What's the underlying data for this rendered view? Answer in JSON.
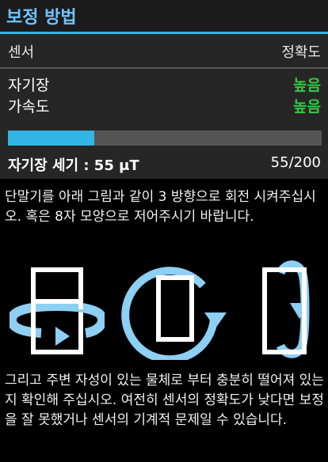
{
  "title": "보정 방법",
  "header": {
    "sensor": "센서",
    "accuracy": "정확도"
  },
  "rows": [
    {
      "label": "자기장",
      "value": "높음"
    },
    {
      "label": "가속도",
      "value": "높음"
    }
  ],
  "progress": {
    "current": 55,
    "max": 200,
    "fraction": 0.275
  },
  "field": {
    "label": "자기장 세기 : 55 μT",
    "value": "55/200"
  },
  "instructions": "단말기를 아래 그림과 같이 3 방향으로 회전 시켜주십시오. 혹은 8자 모양으로 저어주시기 바랍니다.",
  "notes": "그리고 주변 자성이 있는 물체로 부터 충분히 떨어져 있는지 확인해 주십시오. 여전히 센서의 정확도가 낮다면 보정을 잘 못했거나 센서의 기계적 문제일 수 있습니다.",
  "colors": {
    "accent": "#33b5e5",
    "good": "#2ecc40",
    "title": "#6fc3ff"
  },
  "icons": [
    "rotate-horizontal-icon",
    "rotate-planar-icon",
    "rotate-vertical-icon"
  ]
}
